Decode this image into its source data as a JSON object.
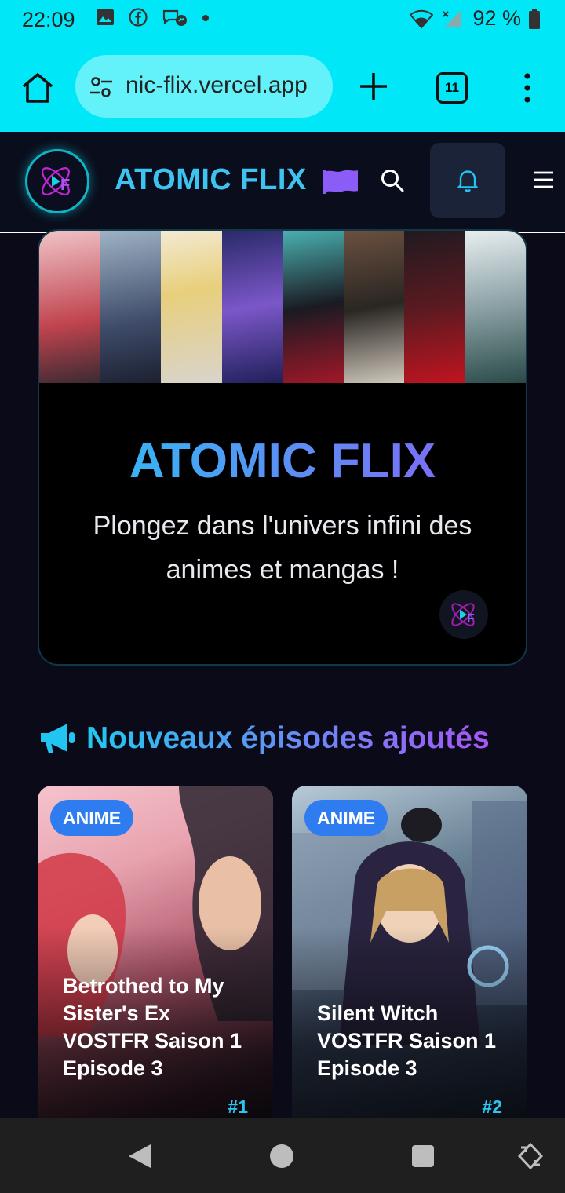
{
  "status_bar": {
    "time": "22:09",
    "battery": "92 %",
    "icons": [
      "gallery-icon",
      "facebook-icon",
      "messenger-icon",
      "notification-dot-icon",
      "wifi-icon",
      "signal-icon",
      "battery-icon"
    ]
  },
  "browser": {
    "url": "nic-flix.vercel.app",
    "tab_count": "11",
    "icons": [
      "home-icon",
      "site-settings-icon",
      "new-tab-icon",
      "tab-switcher-icon",
      "more-menu-icon"
    ]
  },
  "site_nav": {
    "brand": "ATOMIC FLIX",
    "icons": [
      "logo-icon",
      "flag-icon",
      "search-icon",
      "bell-icon",
      "menu-icon"
    ]
  },
  "hero": {
    "title": "ATOMIC FLIX",
    "subtitle": "Plongez dans l'univers infini des animes et mangas !"
  },
  "section": {
    "title": "Nouveaux épisodes ajoutés",
    "icon": "megaphone-icon"
  },
  "cards": [
    {
      "badge": "ANIME",
      "title": "Betrothed to My Sister's Ex VOSTFR Saison 1 Episode 3",
      "rank": "#1"
    },
    {
      "badge": "ANIME",
      "title": "Silent Witch VOSTFR Saison 1 Episode 3",
      "rank": "#2"
    }
  ],
  "colors": {
    "status_bar": "#00e8f8",
    "page_background": "#0a0a18",
    "accent_cyan": "#26c6f3",
    "accent_purple": "#8d5cf6",
    "badge_blue": "#2e7cf0"
  }
}
